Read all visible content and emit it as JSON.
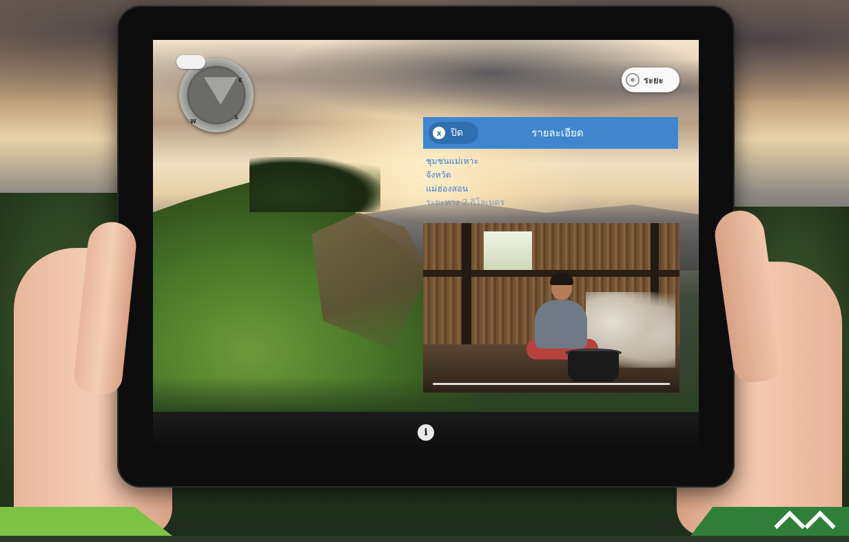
{
  "app": {
    "range_button_label": "ระยะ",
    "compass": {
      "north": "N",
      "east": "E",
      "south": "S",
      "west": "W"
    }
  },
  "detail_panel": {
    "close_label": "ปิด",
    "close_icon_glyph": "x",
    "title": "รายละเอียด",
    "place_name": "ชุมชนแม่เหาะ",
    "province_label": "จังหวัด",
    "province_value": "แม่ฮ่องสอน",
    "distance_text": "ระยะทาง 2 กิโลเมตร"
  },
  "bottom_bar": {
    "info_icon_glyph": "i"
  },
  "colors": {
    "header_blue": "#3f86cf",
    "close_pill_blue": "#2f6fb0",
    "text_blue": "#3e7fd4",
    "brand_green_light": "#7cc243",
    "brand_green_dark": "#2f7f3b"
  }
}
